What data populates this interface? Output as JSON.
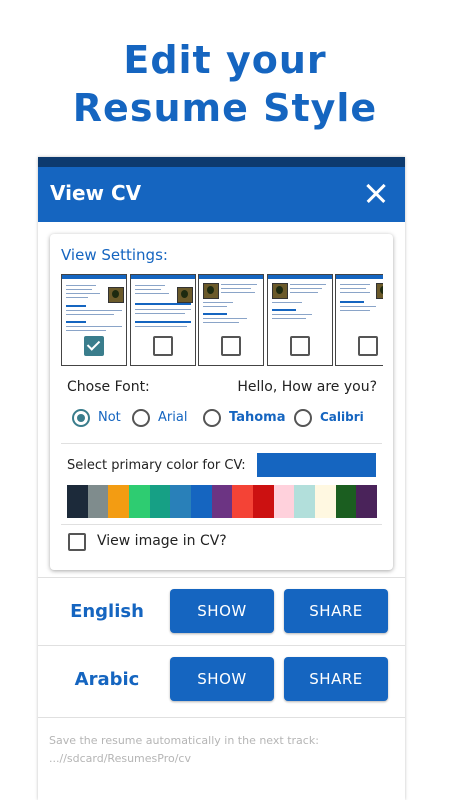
{
  "promo": {
    "line1": "Edit your",
    "line2": "Resume  Style"
  },
  "app_bar": {
    "title": "View CV"
  },
  "settings": {
    "label": "View Settings:",
    "templates": [
      {
        "selected": true
      },
      {
        "selected": false
      },
      {
        "selected": false
      },
      {
        "selected": false
      },
      {
        "selected": false
      }
    ]
  },
  "font": {
    "label": "Chose Font:",
    "preview": "Hello, How are you?",
    "options": [
      {
        "label": "Not",
        "selected": true
      },
      {
        "label": "Arial",
        "selected": false
      },
      {
        "label": "Tahoma",
        "selected": false
      },
      {
        "label": "Calibri",
        "selected": false
      }
    ]
  },
  "color": {
    "label": "Select primary color for CV:",
    "selected": "#1565c0",
    "palette": [
      "#1c2a3a",
      "#7f8c8d",
      "#f39c12",
      "#2ecc71",
      "#16a085",
      "#2980b9",
      "#1565c0",
      "#6c3483",
      "#f44336",
      "#cc1111",
      "#ffd1dc",
      "#b2dfdb",
      "#fff8e1",
      "#1b5e20",
      "#4a235a"
    ]
  },
  "view_image": {
    "label": "View image in CV?",
    "checked": false
  },
  "languages": [
    {
      "name": "English",
      "show": "SHOW",
      "share": "SHARE"
    },
    {
      "name": "Arabic",
      "show": "SHOW",
      "share": "SHARE"
    }
  ],
  "footer": {
    "line1": "Save the resume automatically in the next track:",
    "line2": "...//sdcard/ResumesPro/cv"
  }
}
